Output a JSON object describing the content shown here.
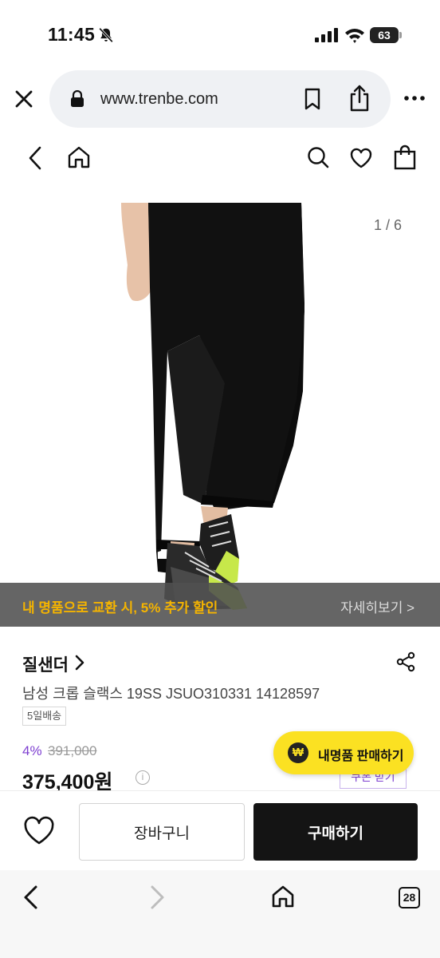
{
  "status_bar": {
    "time": "11:45",
    "battery": "63",
    "icons": [
      "bell-slash-icon",
      "signal-icon",
      "wifi-icon",
      "battery-icon"
    ]
  },
  "browser": {
    "url": "www.trenbe.com",
    "icons": [
      "close-icon",
      "lock-icon",
      "bookmark-icon",
      "share-icon",
      "more-icon"
    ]
  },
  "header": {
    "icons": [
      "back-icon",
      "home-icon",
      "search-icon",
      "heart-icon",
      "shopping-bag-icon"
    ]
  },
  "gallery": {
    "counter": "1 / 6"
  },
  "promo": {
    "text": "내 명품으로 교환 시, 5% 추가 할인",
    "link": "자세히보기 >",
    "color": "#f5b400"
  },
  "product": {
    "brand": "질샌더",
    "title": "남성 크롭 슬랙스 19SS JSUO310331 14128597",
    "delivery_badge": "5일배송",
    "discount": "4%",
    "original_price": "391,000",
    "price": "375,400원",
    "coupon_label": "쿠폰 받기"
  },
  "sell_button": {
    "label": "내명품 판매하기",
    "icon_glyph": "₩",
    "color": "#fbe122"
  },
  "actions": {
    "cart_label": "장바구니",
    "buy_label": "구매하기"
  },
  "browser_toolbar": {
    "tabs_count": "28"
  }
}
